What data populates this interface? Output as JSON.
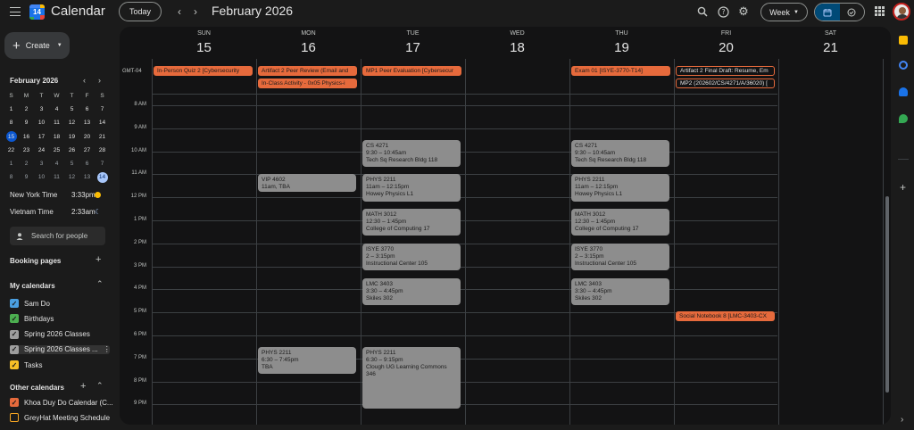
{
  "header": {
    "app_title": "Calendar",
    "logo_number": "14",
    "today_label": "Today",
    "month_title": "February 2026",
    "view_label": "Week"
  },
  "sidebar": {
    "create_label": "Create",
    "mini_month": "February 2026",
    "weekday_initials": [
      "S",
      "M",
      "T",
      "W",
      "T",
      "F",
      "S"
    ],
    "weeks": [
      [
        "1",
        "2",
        "3",
        "4",
        "5",
        "6",
        "7"
      ],
      [
        "8",
        "9",
        "10",
        "11",
        "12",
        "13",
        "14"
      ],
      [
        "15",
        "16",
        "17",
        "18",
        "19",
        "20",
        "21"
      ],
      [
        "22",
        "23",
        "24",
        "25",
        "26",
        "27",
        "28"
      ],
      [
        "1",
        "2",
        "3",
        "4",
        "5",
        "6",
        "7"
      ],
      [
        "8",
        "9",
        "10",
        "11",
        "12",
        "13",
        "14"
      ]
    ],
    "timezones": [
      {
        "name": "New York Time",
        "time": "3:33pm"
      },
      {
        "name": "Vietnam Time",
        "time": "2:33am"
      }
    ],
    "search_people_placeholder": "Search for people",
    "booking_pages_label": "Booking pages",
    "my_calendars_label": "My calendars",
    "my_calendars": [
      {
        "name": "Sam Do",
        "color": "#4a9fe0",
        "checked": true
      },
      {
        "name": "Birthdays",
        "color": "#4caf50",
        "checked": true
      },
      {
        "name": "Spring 2026 Classes",
        "color": "#9e9e9e",
        "checked": true
      },
      {
        "name": "Spring 2026 Classes ...",
        "color": "#9e9e9e",
        "checked": true
      },
      {
        "name": "Tasks",
        "color": "#f6bf26",
        "checked": true
      }
    ],
    "other_calendars_label": "Other calendars",
    "other_calendars": [
      {
        "name": "Khoa Duy Do Calendar (C...",
        "color": "#e66a3c",
        "checked": true
      },
      {
        "name": "GreyHat Meeting Schedule",
        "color": "#f6a623",
        "checked": false
      }
    ]
  },
  "week": {
    "timezone_label": "GMT-04",
    "days": [
      {
        "name": "SUN",
        "date": "15"
      },
      {
        "name": "MON",
        "date": "16"
      },
      {
        "name": "TUE",
        "date": "17"
      },
      {
        "name": "WED",
        "date": "18"
      },
      {
        "name": "THU",
        "date": "19"
      },
      {
        "name": "FRI",
        "date": "20"
      },
      {
        "name": "SAT",
        "date": "21"
      }
    ],
    "hours": [
      "8 AM",
      "9 AM",
      "10 AM",
      "11 AM",
      "12 PM",
      "1 PM",
      "2 PM",
      "3 PM",
      "4 PM",
      "5 PM",
      "6 PM",
      "7 PM",
      "8 PM",
      "9 PM"
    ],
    "allday_events": [
      {
        "day": 0,
        "row": 0,
        "title": "In-Person Quiz 2 [Cybersecurity",
        "outline": false
      },
      {
        "day": 1,
        "row": 0,
        "title": "Artifact 2 Peer Review (Email and",
        "outline": false
      },
      {
        "day": 1,
        "row": 1,
        "title": "In-Class Activity - 0x05 Physics-i",
        "outline": false
      },
      {
        "day": 2,
        "row": 0,
        "title": "MP1 Peer Evaluation [Cybersecur",
        "outline": false
      },
      {
        "day": 4,
        "row": 0,
        "title": "Exam 01 [ISYE-3770-T14]",
        "outline": false
      },
      {
        "day": 5,
        "row": 0,
        "title": "Artifact 2 Final Draft: Resume, Em",
        "outline": true
      },
      {
        "day": 5,
        "row": 1,
        "title": "MP2 (202602/CS/4271/A/36020) [",
        "outline": true
      }
    ],
    "events": [
      {
        "day": 1,
        "start": 11.0,
        "end": 11.83,
        "title": "VIP 4602",
        "time": "11am, TBA",
        "location": ""
      },
      {
        "day": 2,
        "start": 9.5,
        "end": 10.75,
        "title": "CS 4271",
        "time": "9:30 – 10:45am",
        "location": "Tech Sq Research Bldg 118"
      },
      {
        "day": 2,
        "start": 11.0,
        "end": 12.25,
        "title": "PHYS 2211",
        "time": "11am – 12:15pm",
        "location": "Howey Physics L1"
      },
      {
        "day": 2,
        "start": 12.5,
        "end": 13.75,
        "title": "MATH 3012",
        "time": "12:30 – 1:45pm",
        "location": "College of Computing 17"
      },
      {
        "day": 2,
        "start": 14.0,
        "end": 15.25,
        "title": "ISYE 3770",
        "time": "2 – 3:15pm",
        "location": "Instructional Center 105"
      },
      {
        "day": 2,
        "start": 15.5,
        "end": 16.75,
        "title": "LMC 3403",
        "time": "3:30 – 4:45pm",
        "location": "Skiles 302"
      },
      {
        "day": 4,
        "start": 9.5,
        "end": 10.75,
        "title": "CS 4271",
        "time": "9:30 – 10:45am",
        "location": "Tech Sq Research Bldg 118"
      },
      {
        "day": 4,
        "start": 11.0,
        "end": 12.25,
        "title": "PHYS 2211",
        "time": "11am – 12:15pm",
        "location": "Howey Physics L1"
      },
      {
        "day": 4,
        "start": 12.5,
        "end": 13.75,
        "title": "MATH 3012",
        "time": "12:30 – 1:45pm",
        "location": "College of Computing 17"
      },
      {
        "day": 4,
        "start": 14.0,
        "end": 15.25,
        "title": "ISYE 3770",
        "time": "2 – 3:15pm",
        "location": "Instructional Center 105"
      },
      {
        "day": 4,
        "start": 15.5,
        "end": 16.75,
        "title": "LMC 3403",
        "time": "3:30 – 4:45pm",
        "location": "Skiles 302"
      },
      {
        "day": 1,
        "start": 18.5,
        "end": 19.75,
        "title": "PHYS 2211",
        "time": "6:30 – 7:45pm",
        "location": "TBA"
      },
      {
        "day": 2,
        "start": 18.5,
        "end": 21.25,
        "title": "PHYS 2211",
        "time": "6:30 – 9:15pm",
        "location": "Clough UG Learning Commons 346"
      }
    ],
    "timed_tasks": [
      {
        "day": 5,
        "start": 17.0,
        "title": "Social Notebook 8 [LMC-3403-CX"
      }
    ]
  },
  "colors": {
    "accent": "#0b57d0",
    "event_gray": "#8d8d8d",
    "task_orange": "#e66a3c"
  }
}
